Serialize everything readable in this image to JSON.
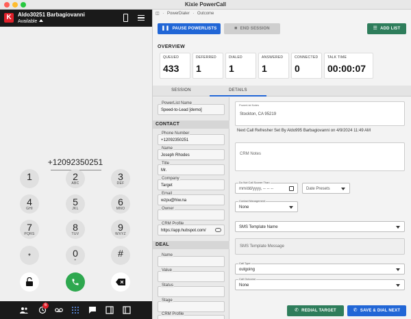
{
  "window": {
    "title": "Kixie PowerCall"
  },
  "agent": {
    "logo": "K",
    "name": "Aldo30251 Barbagiovanni",
    "status": "Available"
  },
  "dialer": {
    "number": "+12092350251",
    "keys": [
      {
        "digit": "1",
        "letters": ""
      },
      {
        "digit": "2",
        "letters": "ABC"
      },
      {
        "digit": "3",
        "letters": "DEF"
      },
      {
        "digit": "4",
        "letters": "GHI"
      },
      {
        "digit": "5",
        "letters": "JKL"
      },
      {
        "digit": "6",
        "letters": "MNO"
      },
      {
        "digit": "7",
        "letters": "PQRS"
      },
      {
        "digit": "8",
        "letters": "TUV"
      },
      {
        "digit": "9",
        "letters": "WXYZ"
      },
      {
        "digit": "*",
        "letters": ""
      },
      {
        "digit": "0",
        "letters": "+"
      },
      {
        "digit": "#",
        "letters": ""
      }
    ]
  },
  "bottom_nav": {
    "badge": "6",
    "icons": [
      "contacts-icon",
      "history-icon",
      "voicemail-icon",
      "dialpad-icon",
      "chat-icon",
      "sidebar-icon",
      "panel-icon"
    ]
  },
  "breadcrumb": {
    "first": "PowerDialer",
    "second": "Outcome"
  },
  "toolbar": {
    "pause_label": "PAUSE POWERLISTS",
    "end_label": "END SESSION",
    "add_label": "ADD LIST"
  },
  "overview": {
    "label": "OVERVIEW",
    "stats": [
      {
        "label": "QUEUED",
        "value": "433"
      },
      {
        "label": "DEFERRED",
        "value": "1"
      },
      {
        "label": "DIALED",
        "value": "1"
      },
      {
        "label": "ANSWERED",
        "value": "1"
      },
      {
        "label": "CONNECTED",
        "value": "0"
      },
      {
        "label": "TALK TIME",
        "value": "00:00:07"
      }
    ]
  },
  "tabs": {
    "session": "SESSION",
    "details": "DETAILS"
  },
  "powerlist": {
    "label": "PowerList Name",
    "value": "Speed-to-Lead [demo]"
  },
  "contact": {
    "header": "CONTACT",
    "fields": [
      {
        "label": "Phone Number",
        "value": "+12092350251"
      },
      {
        "label": "Name",
        "value": "Joseph Rhodes"
      },
      {
        "label": "Title",
        "value": "Mr."
      },
      {
        "label": "Company",
        "value": "Target"
      },
      {
        "label": "Email",
        "value": "wzpu@hiw.na"
      },
      {
        "label": "Owner",
        "value": ""
      },
      {
        "label": "CRM Profile",
        "value": "https://app.hubspot.com/"
      }
    ]
  },
  "deal": {
    "header": "DEAL",
    "fields": [
      {
        "label": "Name",
        "value": ""
      },
      {
        "label": "Value",
        "value": ""
      },
      {
        "label": "Status",
        "value": ""
      },
      {
        "label": "Stage",
        "value": ""
      },
      {
        "label": "CRM Profile",
        "value": ""
      }
    ]
  },
  "details": {
    "powerlist_notes_label": "PowerList Notes",
    "powerlist_notes_value": "Stockton, CA 95219",
    "refresher": "Next Call Refresher Set By Aldo995 Barbagiovanni on 4/9/2024 11:49 AM",
    "crm_notes_placeholder": "CRM Notes",
    "dnc_label": "Do Not Call Sooner Than",
    "dnc_placeholder": "mm/dd/yyyy, -- -- --",
    "date_presets": "Date Presets",
    "contact_mgmt_label": "Contact Management",
    "contact_mgmt_value": "None",
    "sms_template_name": "SMS Template Name",
    "sms_template_message": "SMS Template Message",
    "call_type_label": "Call Type",
    "call_type_value": "outgoing",
    "call_outcome_label": "Call Outcome",
    "call_outcome_value": "None"
  },
  "actions": {
    "redial_label": "REDIAL TARGET",
    "save_label": "SAVE & DIAL NEXT"
  },
  "colors": {
    "primary": "#2166d6",
    "success": "#2e7d5b",
    "call": "#2ea84f",
    "brand": "#e0202a"
  }
}
